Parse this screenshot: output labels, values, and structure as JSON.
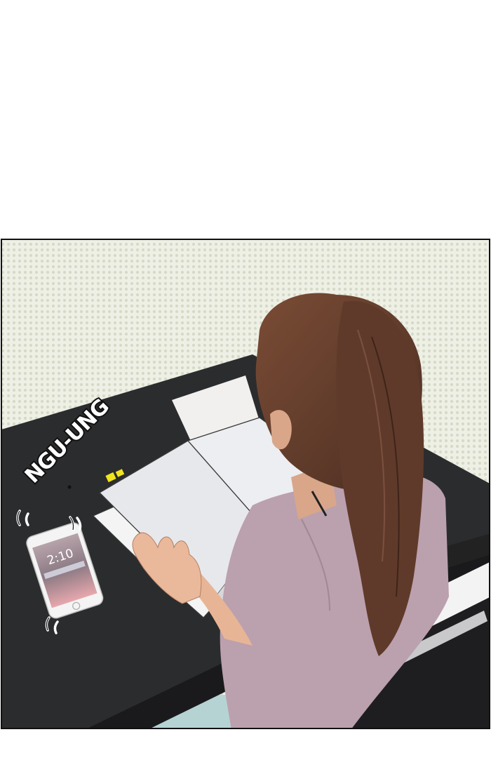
{
  "panel": {
    "sfx_text": "NGU-UNG",
    "phone_time": "2:10"
  },
  "colors": {
    "background_dots": "#dfe3d2",
    "desk": "#2b2c2e",
    "shirt": "#bba0ae",
    "hair": "#6b4330",
    "skin": "#eab89b",
    "book_pages": "#eaebee",
    "sticky_note": "#f1e41d"
  }
}
